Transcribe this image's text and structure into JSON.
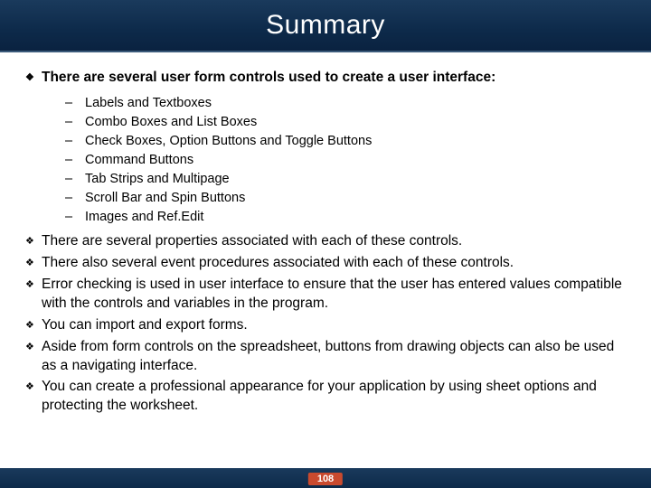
{
  "title": "Summary",
  "intro": "There are several user form controls used to create a user interface:",
  "sub_items": [
    "Labels and Textboxes",
    "Combo Boxes and List Boxes",
    "Check Boxes, Option Buttons and Toggle Buttons",
    "Command Buttons",
    "Tab Strips and Multipage",
    "Scroll Bar and Spin Buttons",
    "Images and Ref.Edit"
  ],
  "bullets": [
    "There are several properties associated with each of these controls.",
    "There also several event procedures associated with each of these controls.",
    "Error checking is used in user interface to ensure that the user has entered values compatible with the controls and variables in the program.",
    "You can import and export forms.",
    "Aside from form controls on the spreadsheet, buttons from drawing objects can also be used as a navigating interface.",
    "You can create a professional appearance for your application by using sheet options and protecting the worksheet."
  ],
  "page_number": "108"
}
